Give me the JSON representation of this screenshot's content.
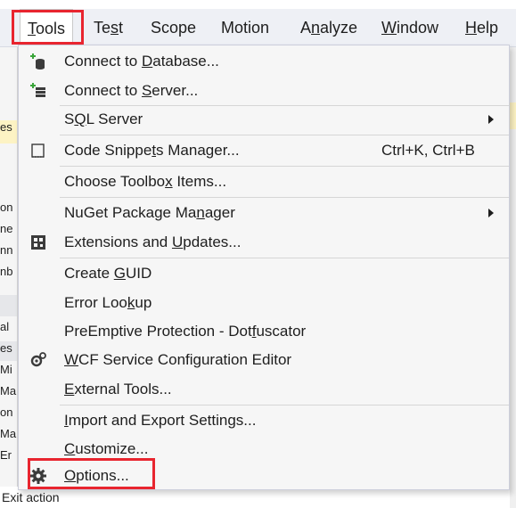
{
  "menubar": {
    "items": [
      {
        "pre": "",
        "acc": "T",
        "post": "ools"
      },
      {
        "pre": "Te",
        "acc": "s",
        "post": "t"
      },
      {
        "pre": "Scope",
        "acc": "",
        "post": ""
      },
      {
        "pre": "Motion",
        "acc": "",
        "post": ""
      },
      {
        "pre": "A",
        "acc": "n",
        "post": "alyze"
      },
      {
        "pre": "",
        "acc": "W",
        "post": "indow"
      },
      {
        "pre": "",
        "acc": "H",
        "post": "elp"
      }
    ]
  },
  "tools_menu": {
    "items": [
      {
        "pre": "Connect to ",
        "acc": "D",
        "post": "atabase...",
        "icon": "connect-database-icon",
        "shortcut": "",
        "submenu": false
      },
      {
        "pre": "Connect to ",
        "acc": "S",
        "post": "erver...",
        "icon": "connect-server-icon",
        "shortcut": "",
        "submenu": false
      },
      {
        "pre": "S",
        "acc": "Q",
        "post": "L Server",
        "icon": "",
        "shortcut": "",
        "submenu": true
      },
      {
        "pre": "Code Snippe",
        "acc": "t",
        "post": "s Manager...",
        "icon": "code-snippets-icon",
        "shortcut": "Ctrl+K, Ctrl+B",
        "submenu": false
      },
      {
        "pre": "Choose Toolbo",
        "acc": "x",
        "post": " Items...",
        "icon": "",
        "shortcut": "",
        "submenu": false
      },
      {
        "pre": "NuGet Package Ma",
        "acc": "n",
        "post": "ager",
        "icon": "",
        "shortcut": "",
        "submenu": true
      },
      {
        "pre": "Extensions and ",
        "acc": "U",
        "post": "pdates...",
        "icon": "extensions-icon",
        "shortcut": "",
        "submenu": false
      },
      {
        "pre": "Create ",
        "acc": "G",
        "post": "UID",
        "icon": "",
        "shortcut": "",
        "submenu": false
      },
      {
        "pre": "Error Loo",
        "acc": "k",
        "post": "up",
        "icon": "",
        "shortcut": "",
        "submenu": false
      },
      {
        "pre": "PreEmptive Protection - Dot",
        "acc": "f",
        "post": "uscator",
        "icon": "",
        "shortcut": "",
        "submenu": false
      },
      {
        "pre": "",
        "acc": "W",
        "post": "CF Service Configuration Editor",
        "icon": "wcf-config-icon",
        "shortcut": "",
        "submenu": false
      },
      {
        "pre": "",
        "acc": "E",
        "post": "xternal Tools...",
        "icon": "",
        "shortcut": "",
        "submenu": false
      },
      {
        "pre": "",
        "acc": "I",
        "post": "mport and Export Settings...",
        "icon": "",
        "shortcut": "",
        "submenu": false
      },
      {
        "pre": "",
        "acc": "C",
        "post": "ustomize...",
        "icon": "",
        "shortcut": "",
        "submenu": false
      },
      {
        "pre": "",
        "acc": "O",
        "post": "ptions...",
        "icon": "gear-icon",
        "shortcut": "",
        "submenu": false
      }
    ]
  },
  "background": {
    "fragments": [
      "es",
      "on",
      "ne",
      "nn",
      "nb",
      "al",
      "es",
      "Mi",
      "Ma",
      "on",
      "Ma",
      "Er"
    ],
    "bottom_label": "Exit action"
  },
  "colors": {
    "highlight": "#e8252f",
    "menubar_bg": "#eef0f5",
    "menu_bg": "#f6f6f6"
  }
}
